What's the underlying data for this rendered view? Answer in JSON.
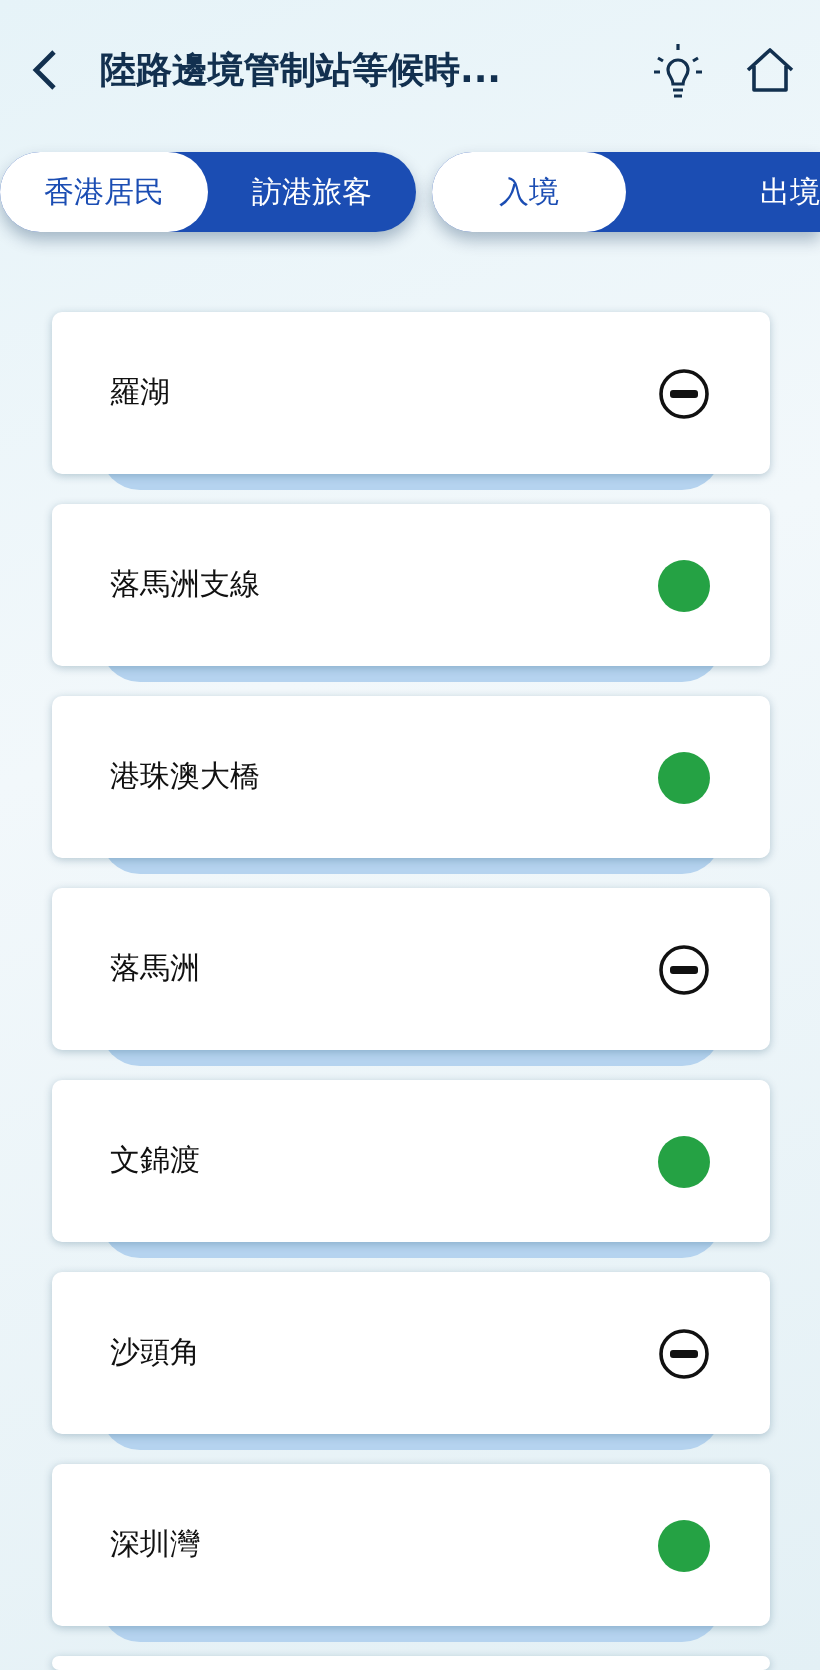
{
  "header": {
    "title": "陸路邊境管制站等候時..."
  },
  "traveller_toggle": [
    {
      "label": "香港居民",
      "selected": true
    },
    {
      "label": "訪港旅客",
      "selected": false
    }
  ],
  "direction_toggle": [
    {
      "label": "入境",
      "selected": true
    },
    {
      "label": "出境",
      "selected": false
    }
  ],
  "stations": [
    {
      "name": "羅湖",
      "kind": "closed"
    },
    {
      "name": "落馬洲支線",
      "kind": "normal"
    },
    {
      "name": "港珠澳大橋",
      "kind": "normal"
    },
    {
      "name": "落馬洲",
      "kind": "closed"
    },
    {
      "name": "文錦渡",
      "kind": "normal"
    },
    {
      "name": "沙頭角",
      "kind": "closed"
    },
    {
      "name": "深圳灣",
      "kind": "normal"
    }
  ]
}
